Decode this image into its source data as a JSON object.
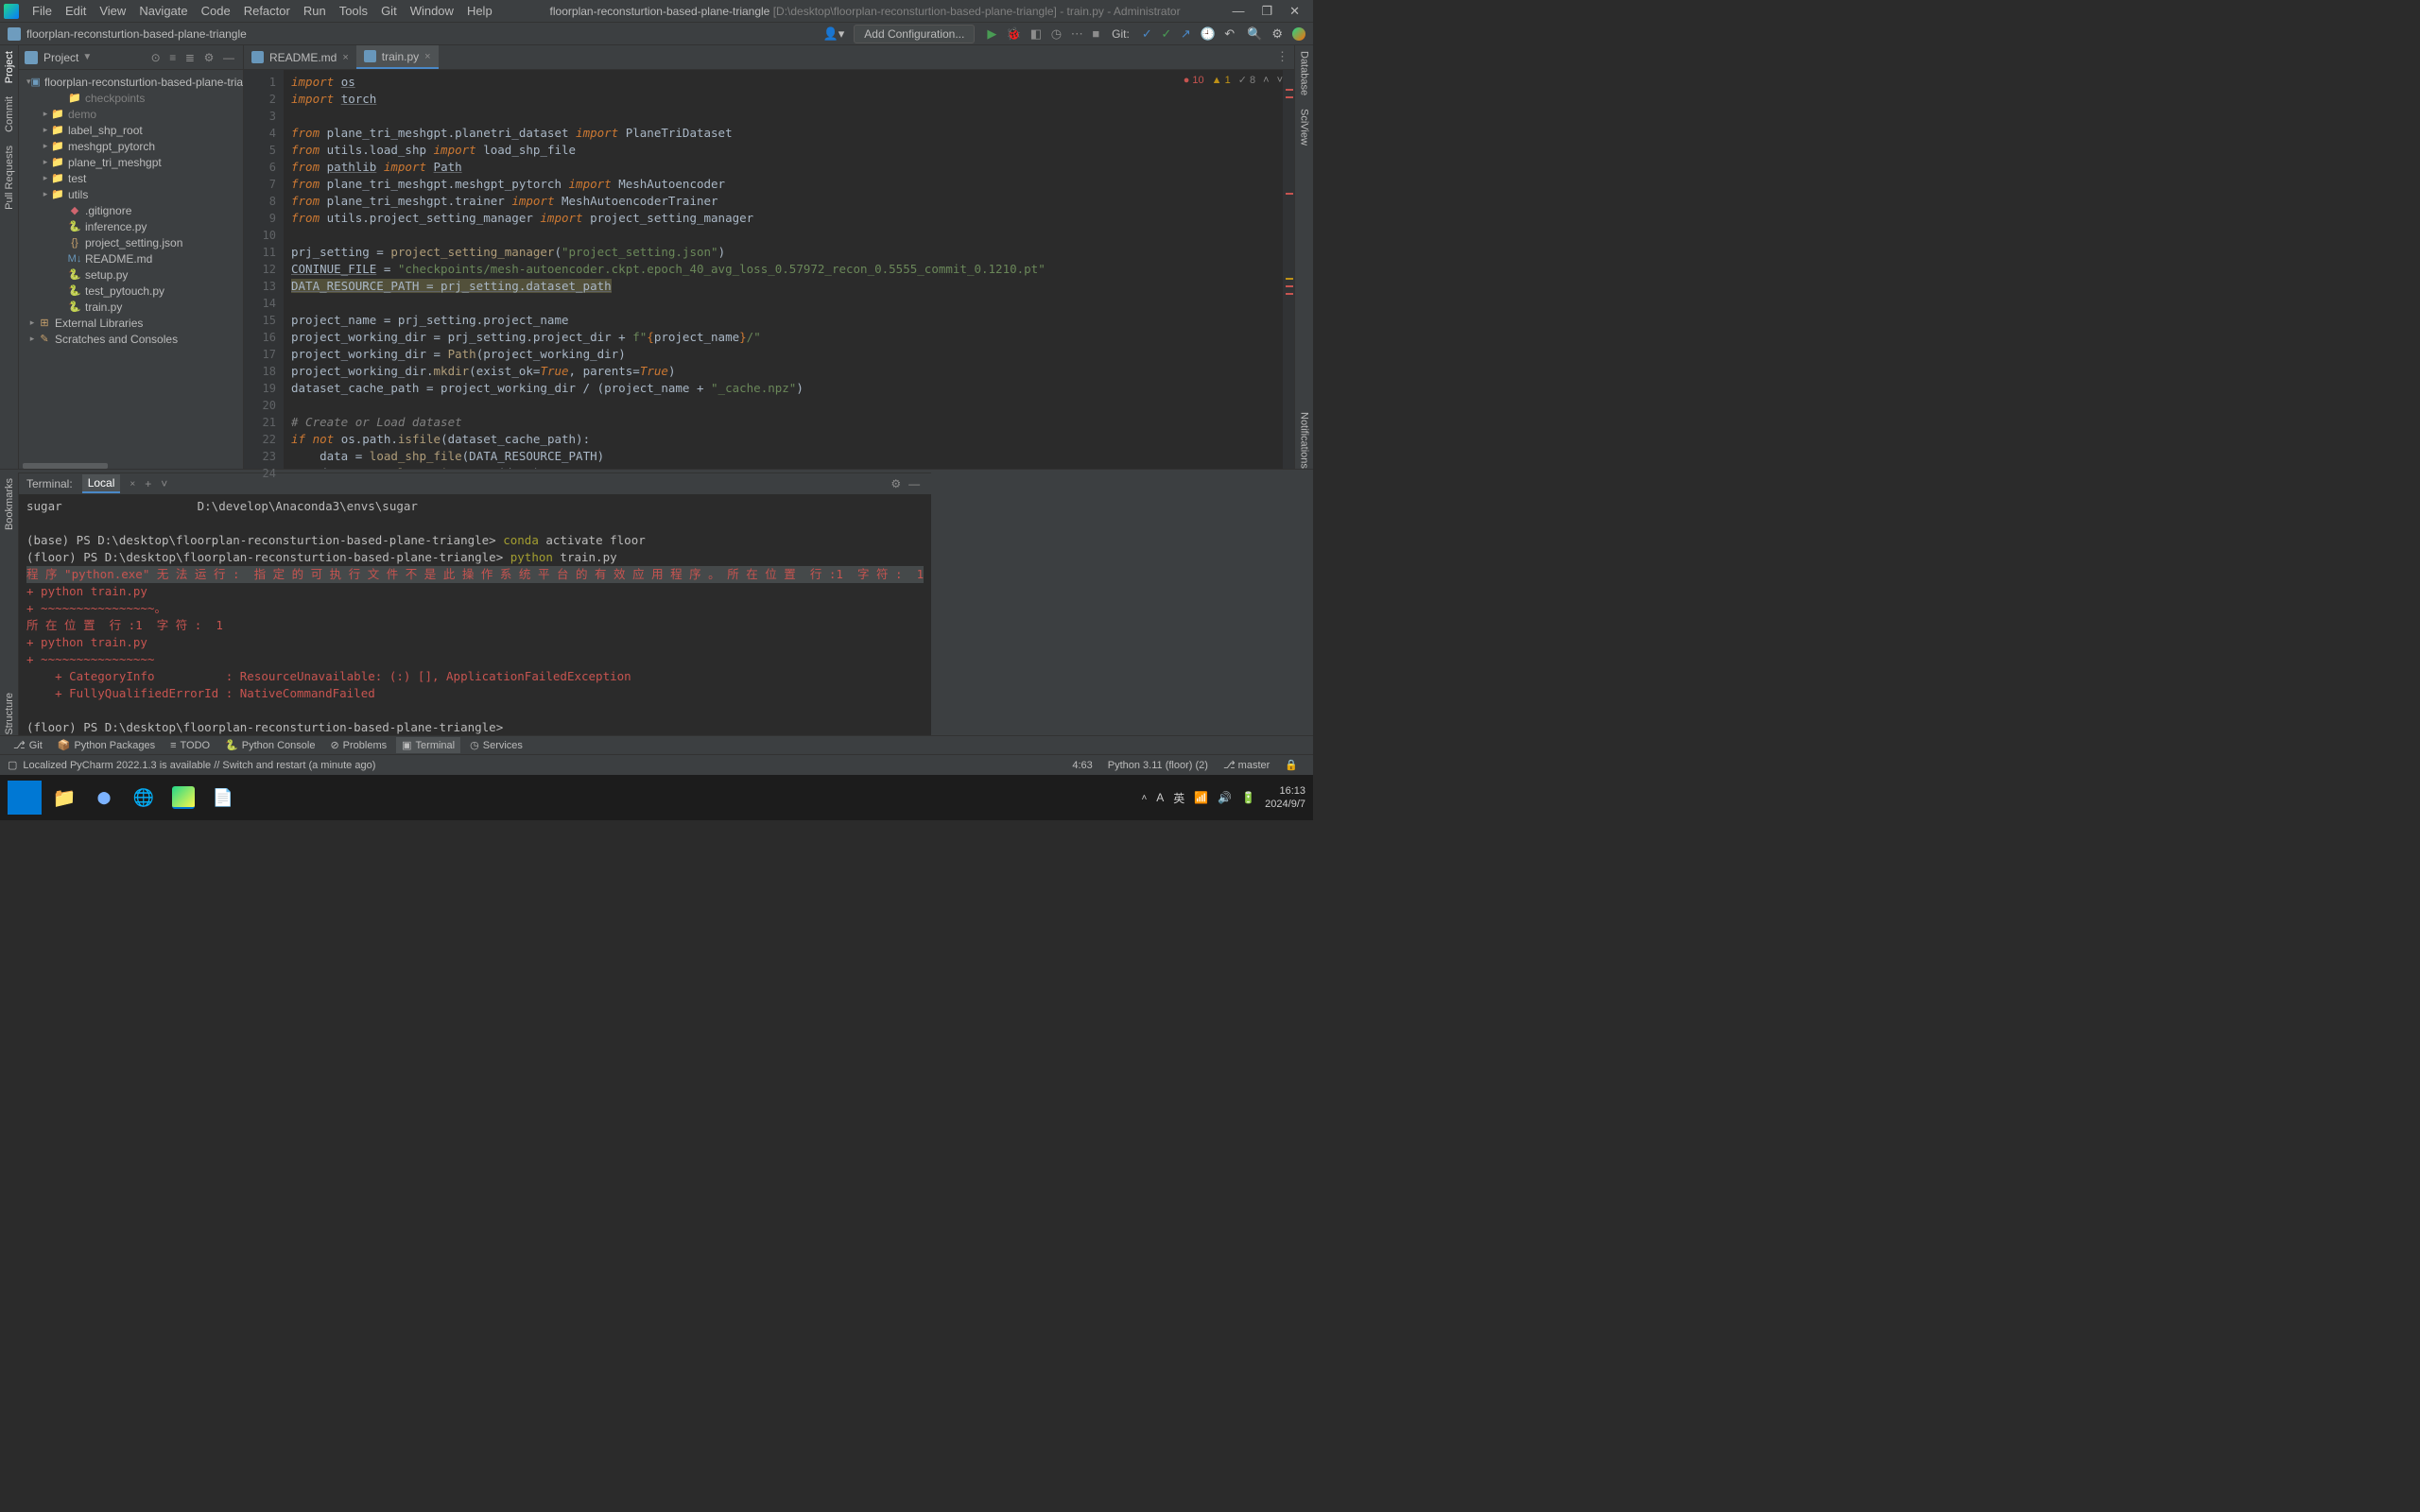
{
  "menu": [
    "File",
    "Edit",
    "View",
    "Navigate",
    "Code",
    "Refactor",
    "Run",
    "Tools",
    "Git",
    "Window",
    "Help"
  ],
  "title": {
    "project": "floorplan-reconsturtion-based-plane-triangle",
    "path": "[D:\\desktop\\floorplan-reconsturtion-based-plane-triangle] - train.py - Administrator"
  },
  "breadcrumb": "floorplan-reconsturtion-based-plane-triangle",
  "add_config": "Add Configuration...",
  "git_label": "Git:",
  "left_tools": {
    "project": "Project",
    "commit": "Commit",
    "pr": "Pull Requests",
    "bookmarks": "Bookmarks",
    "structure": "Structure"
  },
  "right_tools": {
    "notifications": "Notifications",
    "sciview": "SciView",
    "database": "Database"
  },
  "project_header": {
    "title": "Project"
  },
  "tree": {
    "root": "floorplan-reconsturtion-based-plane-trian",
    "checkpoints": "checkpoints",
    "demo": "demo",
    "label_shp_root": "label_shp_root",
    "meshgpt_pytorch": "meshgpt_pytorch",
    "plane_tri_meshgpt": "plane_tri_meshgpt",
    "test": "test",
    "utils": "utils",
    "gitignore": ".gitignore",
    "inference": "inference.py",
    "project_setting": "project_setting.json",
    "readme": "README.md",
    "setup": "setup.py",
    "test_pytouch": "test_pytouch.py",
    "train": "train.py",
    "ext_lib": "External Libraries",
    "scratches": "Scratches and Consoles"
  },
  "tabs": {
    "readme": "README.md",
    "train": "train.py"
  },
  "inspections": {
    "errors": "10",
    "warnings": "1",
    "weak": "8"
  },
  "gutter": [
    "1",
    "2",
    "3",
    "4",
    "5",
    "6",
    "7",
    "8",
    "9",
    "10",
    "11",
    "12",
    "13",
    "14",
    "15",
    "16",
    "17",
    "18",
    "19",
    "20",
    "21",
    "22",
    "23",
    "24"
  ],
  "code": {
    "l1a": "import",
    "l1b": "os",
    "l2a": "import",
    "l2b": "torch",
    "l4a": "from",
    "l4b": " plane_tri_meshgpt.planetri_dataset ",
    "l4c": "import",
    "l4d": " PlaneTriDataset",
    "l5a": "from",
    "l5b": " utils.load_shp ",
    "l5c": "import",
    "l5d": " load_shp_file",
    "l6a": "from",
    "l6b": "pathlib",
    "l6c": "import",
    "l6d": "Path",
    "l7a": "from",
    "l7b": " plane_tri_meshgpt.meshgpt_pytorch ",
    "l7c": "import",
    "l7d": " MeshAutoencoder",
    "l8a": "from",
    "l8b": " plane_tri_meshgpt.trainer ",
    "l8c": "import",
    "l8d": " MeshAutoencoderTrainer",
    "l9a": "from",
    "l9b": " utils.project_setting_manager ",
    "l9c": "import",
    "l9d": " project_setting_manager",
    "l11a": "prj_setting = ",
    "l11b": "project_setting_manager",
    "l11c": "(",
    "l11d": "\"project_setting.json\"",
    "l11e": ")",
    "l12a": "CONINUE_FILE",
    "l12b": " = ",
    "l12c": "\"checkpoints/mesh-autoencoder.ckpt.epoch_40_avg_loss_0.57972_recon_0.5555_commit_0.1210.pt\"",
    "l13a": "DATA_RESOURCE_PATH = prj_setting.dataset_path",
    "l15": "project_name = prj_setting.project_name",
    "l16a": "project_working_dir = prj_setting.project_dir + ",
    "l16b": "f\"",
    "l16c": "{",
    "l16d": "project_name",
    "l16e": "}",
    "l16f": "/\"",
    "l17a": "project_working_dir = ",
    "l17b": "Path",
    "l17c": "(project_working_dir)",
    "l18a": "project_working_dir.",
    "l18b": "mkdir",
    "l18c": "(",
    "l18d": "exist_ok",
    "l18e": "=",
    "l18f": "True",
    "l18g": ", ",
    "l18h": "parents",
    "l18i": "=",
    "l18j": "True",
    "l18k": ")",
    "l19a": "dataset_cache_path = project_working_dir / (project_name + ",
    "l19b": "\"_cache.npz\"",
    "l19c": ")",
    "l21": "# Create or Load dataset",
    "l22a": "if",
    "l22b": "not",
    "l22c": " os.path.",
    "l22d": "isfile",
    "l22e": "(dataset_cache_path):",
    "l23a": "    data = ",
    "l23b": "load_shp_file",
    "l23c": "(DATA_RESOURCE_PATH)",
    "l24a": "    dataset = ",
    "l24b": "PlaneTriDataset",
    "l24c": "(data)"
  },
  "terminal": {
    "title": "Terminal:",
    "tab": "Local",
    "l1a": "sugar",
    "l1b": "                   D:\\develop\\Anaconda3\\envs\\sugar",
    "l2": "",
    "l3a": "(base) PS D:\\desktop\\floorplan-reconsturtion-based-plane-triangle> ",
    "l3b": "conda",
    "l3c": " activate floor",
    "l4a": "(floor) PS D:\\desktop\\floorplan-reconsturtion-based-plane-triangle> ",
    "l4b": "python",
    "l4c": " train.py",
    "l5": "程 序 \"python.exe\" 无 法 运 行 :  指 定 的 可 执 行 文 件 不 是 此 操 作 系 统 平 台 的 有 效 应 用 程 序 。 所 在 位 置  行 :1  字 符 :  1",
    "l6": "+ python train.py",
    "l7": "+ ~~~~~~~~~~~~~~~~。",
    "l8": "所 在 位 置  行 :1  字 符 :  1",
    "l9": "+ python train.py",
    "l10": "+ ~~~~~~~~~~~~~~~~",
    "l11": "    + CategoryInfo          : ResourceUnavailable: (:) [], ApplicationFailedException",
    "l12": "    + FullyQualifiedErrorId : NativeCommandFailed",
    "l13": "",
    "l14": "(floor) PS D:\\desktop\\floorplan-reconsturtion-based-plane-triangle>"
  },
  "bottom_tabs": {
    "git": "Git",
    "pkg": "Python Packages",
    "todo": "TODO",
    "console": "Python Console",
    "problems": "Problems",
    "terminal": "Terminal",
    "services": "Services"
  },
  "status": {
    "msg": "Localized PyCharm 2022.1.3 is available // Switch and restart (a minute ago)",
    "pos": "4:63",
    "interp": "Python 3.11 (floor) (2)",
    "branch": "master"
  },
  "tray": {
    "ime1": "A",
    "ime2": "英",
    "time": "16:13",
    "date": "2024/9/7"
  }
}
